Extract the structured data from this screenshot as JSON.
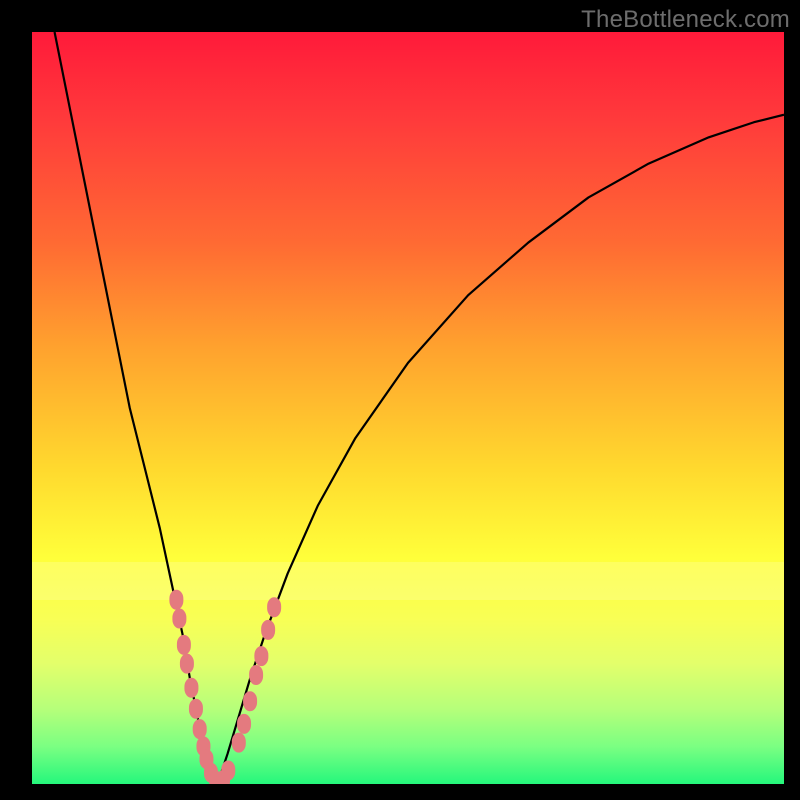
{
  "watermark": "TheBottleneck.com",
  "colors": {
    "frame": "#000000",
    "gradient_top": "#ff1a3a",
    "gradient_bottom": "#25f77c",
    "curve": "#000000",
    "marker": "#e47a7f"
  },
  "chart_data": {
    "type": "line",
    "title": "",
    "xlabel": "",
    "ylabel": "",
    "xlim": [
      0,
      100
    ],
    "ylim": [
      0,
      100
    ],
    "series": [
      {
        "name": "left-branch",
        "x": [
          3,
          5,
          7,
          9,
          11,
          13,
          15,
          17,
          18.5,
          20,
          21,
          22,
          22.8,
          23.5,
          24,
          24.5
        ],
        "y": [
          100,
          90,
          80,
          70,
          60,
          50,
          42,
          34,
          27,
          20,
          14,
          9,
          5,
          2.5,
          1,
          0
        ]
      },
      {
        "name": "right-branch",
        "x": [
          24.5,
          25,
          26,
          27.5,
          29,
          31,
          34,
          38,
          43,
          50,
          58,
          66,
          74,
          82,
          90,
          96,
          100
        ],
        "y": [
          0,
          1,
          4,
          9,
          14,
          20,
          28,
          37,
          46,
          56,
          65,
          72,
          78,
          82.5,
          86,
          88,
          89
        ]
      }
    ],
    "markers": {
      "name": "data-points",
      "points": [
        {
          "x": 19.2,
          "y": 24.5
        },
        {
          "x": 19.6,
          "y": 22.0
        },
        {
          "x": 20.2,
          "y": 18.5
        },
        {
          "x": 20.6,
          "y": 16.0
        },
        {
          "x": 21.2,
          "y": 12.8
        },
        {
          "x": 21.8,
          "y": 10.0
        },
        {
          "x": 22.3,
          "y": 7.3
        },
        {
          "x": 22.8,
          "y": 5.0
        },
        {
          "x": 23.2,
          "y": 3.3
        },
        {
          "x": 23.8,
          "y": 1.5
        },
        {
          "x": 24.5,
          "y": 0.4
        },
        {
          "x": 25.4,
          "y": 0.5
        },
        {
          "x": 26.1,
          "y": 1.8
        },
        {
          "x": 27.5,
          "y": 5.5
        },
        {
          "x": 28.2,
          "y": 8.0
        },
        {
          "x": 29.0,
          "y": 11.0
        },
        {
          "x": 29.8,
          "y": 14.5
        },
        {
          "x": 30.5,
          "y": 17.0
        },
        {
          "x": 31.4,
          "y": 20.5
        },
        {
          "x": 32.2,
          "y": 23.5
        }
      ]
    }
  }
}
